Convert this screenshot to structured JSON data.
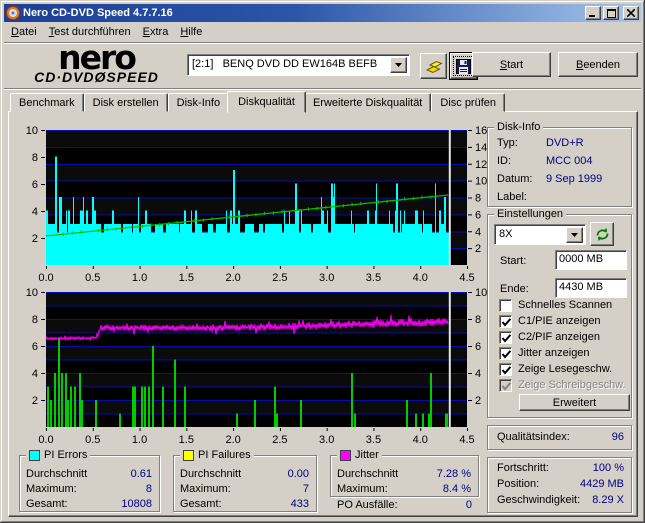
{
  "window": {
    "title": "Nero CD-DVD Speed 4.7.7.16"
  },
  "menu": {
    "items": [
      {
        "label": "Datei"
      },
      {
        "label": "Test durchführen"
      },
      {
        "label": "Extra"
      },
      {
        "label": "Hilfe"
      }
    ]
  },
  "toolbar": {
    "logo_main": "nero",
    "logo_sub": "CD·DVDØSPEED",
    "drive_select_value": "[2:1]   BENQ DVD DD EW164B BEFB",
    "start_label": "Start",
    "quit_label": "Beenden"
  },
  "tabs": [
    {
      "label": "Benchmark"
    },
    {
      "label": "Disk erstellen"
    },
    {
      "label": "Disk-Info"
    },
    {
      "label": "Diskqualität"
    },
    {
      "label": "Erweiterte Diskqualität"
    },
    {
      "label": "Disc prüfen"
    }
  ],
  "disk_info": {
    "title": "Disk-Info",
    "rows": [
      [
        "Typ:",
        "DVD+R"
      ],
      [
        "ID:",
        "MCC 004"
      ],
      [
        "Datum:",
        "9 Sep 1999"
      ],
      [
        "Label:",
        ""
      ]
    ]
  },
  "settings": {
    "title": "Einstellungen",
    "speed_value": "8X",
    "start_label": "Start:",
    "start_value": "0000 MB",
    "end_label": "Ende:",
    "end_value": "4430 MB",
    "checkboxes": [
      {
        "label": "Schnelles Scannen",
        "checked": false,
        "disabled": false
      },
      {
        "label": "C1/PIE anzeigen",
        "checked": true,
        "disabled": false
      },
      {
        "label": "C2/PIF anzeigen",
        "checked": true,
        "disabled": false
      },
      {
        "label": "Jitter anzeigen",
        "checked": true,
        "disabled": false
      },
      {
        "label": "Zeige Lesegeschw.",
        "checked": true,
        "disabled": false
      },
      {
        "label": "Zeige Schreibgeschw.",
        "checked": true,
        "disabled": true
      }
    ],
    "advanced_label": "Erweitert"
  },
  "quality": {
    "label": "Qualitätsindex:",
    "value": "96"
  },
  "progress": {
    "rows": [
      [
        "Fortschritt:",
        "100 %"
      ],
      [
        "Position:",
        "4429 MB"
      ],
      [
        "Geschwindigkeit:",
        "8.29 X"
      ]
    ]
  },
  "stats": {
    "pi_errors": {
      "title": "PI Errors",
      "swatch": "#00ffff",
      "rows": [
        [
          "Durchschnitt",
          "0.61"
        ],
        [
          "Maximum:",
          "8"
        ],
        [
          "Gesamt:",
          "10808"
        ]
      ]
    },
    "pi_failures": {
      "title": "PI Failures",
      "swatch": "#ffff00",
      "rows": [
        [
          "Durchschnitt",
          "0.00"
        ],
        [
          "Maximum:",
          "7"
        ],
        [
          "Gesamt:",
          "433"
        ]
      ]
    },
    "jitter": {
      "title": "Jitter",
      "swatch": "#ff00ff",
      "rows": [
        [
          "Durchschnitt",
          "7.28 %"
        ],
        [
          "Maximum:",
          "8.4 %"
        ]
      ]
    },
    "po_failures": {
      "label": "PO Ausfälle:",
      "value": "0"
    }
  },
  "chart_data": {
    "type": "line",
    "x_unit": "GB",
    "x_ticks": [
      "0.0",
      "0.5",
      "1.0",
      "1.5",
      "2.0",
      "2.5",
      "3.0",
      "3.5",
      "4.0",
      "4.5"
    ],
    "x_max": 4.5,
    "scan_end": 4.3,
    "grid_color": "#0b0bab",
    "bg_color": "#000000",
    "band_color": "#0b0b0b",
    "position_line_color": "#e6e6e6",
    "top_chart": {
      "title": "PI Errors / read speed",
      "left_axis": {
        "ticks": [
          10,
          8,
          6,
          4,
          2
        ],
        "max": 10
      },
      "right_axis": {
        "ticks": [
          16,
          14,
          12,
          10,
          8,
          6,
          4,
          2
        ],
        "max": 16
      },
      "pi_errors_bars": {
        "color": "#00ffff",
        "seed": 1337,
        "levels": [
          2.4,
          3.05,
          4.05,
          5.05,
          6.05
        ],
        "weights": [
          0.25,
          0.42,
          0.23,
          0.07,
          0.03
        ],
        "peaks": [
          [
            0.095,
            8.05
          ],
          [
            2.0,
            7.05
          ]
        ]
      },
      "read_speed_line": {
        "color": "#00c000",
        "start_value": 3.44,
        "end_value": 8.3
      }
    },
    "bottom_chart": {
      "title": "PI Failures / Jitter",
      "left_axis": {
        "ticks": [
          10,
          8,
          6,
          4,
          2
        ],
        "max": 10
      },
      "right_axis": {
        "ticks": [
          10,
          8,
          6,
          4,
          2
        ],
        "max": 10
      },
      "jitter_line": {
        "color": "#ff00ff",
        "seed": 4242,
        "noise": 0.26,
        "points": [
          [
            0,
            6.55
          ],
          [
            0.54,
            6.6
          ],
          [
            0.58,
            7.35
          ],
          [
            1.5,
            7.33
          ],
          [
            2.5,
            7.42
          ],
          [
            3.2,
            7.58
          ],
          [
            4.3,
            7.8
          ]
        ]
      },
      "pif_spikes": {
        "color": "#00cc00",
        "values": [
          [
            0.02,
            3
          ],
          [
            0.05,
            2
          ],
          [
            0.1,
            4
          ],
          [
            0.136,
            6.6
          ],
          [
            0.17,
            4
          ],
          [
            0.21,
            4
          ],
          [
            0.24,
            2
          ],
          [
            0.27,
            3
          ],
          [
            0.31,
            3
          ],
          [
            0.36,
            4
          ],
          [
            0.39,
            2
          ],
          [
            0.53,
            2
          ],
          [
            0.79,
            1
          ],
          [
            0.93,
            3
          ],
          [
            0.95,
            3
          ],
          [
            1.03,
            3
          ],
          [
            1.06,
            3
          ],
          [
            1.1,
            3
          ],
          [
            1.14,
            6
          ],
          [
            1.25,
            3
          ],
          [
            1.38,
            5
          ],
          [
            1.49,
            3
          ],
          [
            2.04,
            1
          ],
          [
            2.23,
            2
          ],
          [
            2.45,
            3
          ],
          [
            2.47,
            1
          ],
          [
            2.73,
            2
          ],
          [
            3.27,
            4
          ],
          [
            3.3,
            1
          ],
          [
            3.86,
            2
          ],
          [
            3.95,
            1
          ],
          [
            4.03,
            1
          ],
          [
            4.09,
            1
          ],
          [
            4.11,
            4
          ],
          [
            4.28,
            1
          ],
          [
            4.29,
            1
          ]
        ]
      }
    }
  }
}
